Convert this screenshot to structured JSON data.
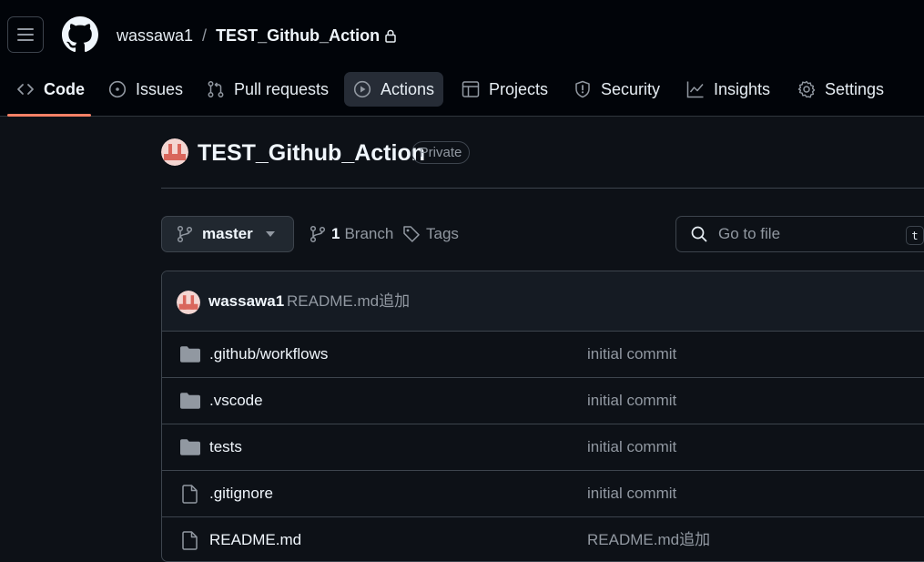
{
  "header": {
    "owner": "wassawa1",
    "separator": "/",
    "repo": "TEST_Github_Action"
  },
  "tabs": [
    {
      "label": "Code",
      "icon": "code-icon"
    },
    {
      "label": "Issues",
      "icon": "issue-icon"
    },
    {
      "label": "Pull requests",
      "icon": "pull-request-icon"
    },
    {
      "label": "Actions",
      "icon": "play-icon"
    },
    {
      "label": "Projects",
      "icon": "table-icon"
    },
    {
      "label": "Security",
      "icon": "shield-icon"
    },
    {
      "label": "Insights",
      "icon": "graph-icon"
    },
    {
      "label": "Settings",
      "icon": "gear-icon"
    }
  ],
  "repo": {
    "name": "TEST_Github_Action",
    "visibility": "Private"
  },
  "branch": {
    "current": "master",
    "count": "1",
    "count_label": "Branch",
    "tags_label": "Tags"
  },
  "search": {
    "placeholder": "Go to file",
    "shortcut": "t"
  },
  "commit": {
    "author": "wassawa1",
    "message": "README.md追加"
  },
  "files": [
    {
      "name": ".github/workflows",
      "type": "folder",
      "message": "initial commit"
    },
    {
      "name": ".vscode",
      "type": "folder",
      "message": "initial commit"
    },
    {
      "name": "tests",
      "type": "folder",
      "message": "initial commit"
    },
    {
      "name": ".gitignore",
      "type": "file",
      "message": "initial commit"
    },
    {
      "name": "README.md",
      "type": "file",
      "message": "README.md追加"
    }
  ],
  "colors": {
    "background": "#0d1117",
    "header": "#010409",
    "accent_underline": "#f78166",
    "muted_text": "#9198a1",
    "border": "#3d444d"
  }
}
